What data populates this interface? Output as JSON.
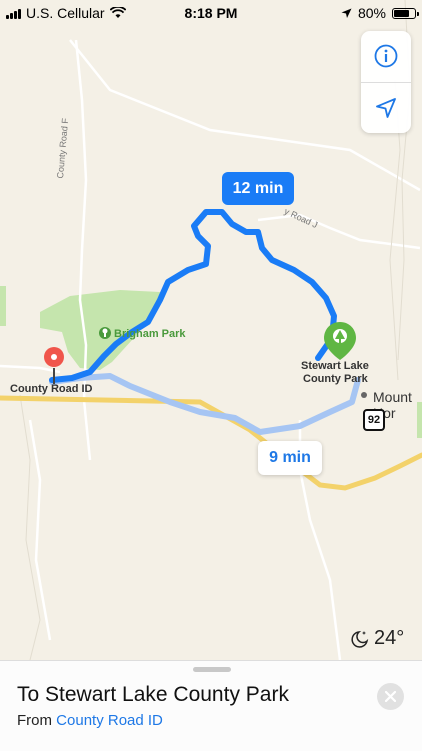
{
  "status_bar": {
    "carrier": "U.S. Cellular",
    "time": "8:18 PM",
    "battery_percent": "80%",
    "battery_level": 0.8
  },
  "map": {
    "routes": {
      "main_time": "12 min",
      "alt_time": "9 min"
    },
    "labels": {
      "origin": "County Road ID",
      "destination_line1": "Stewart Lake",
      "destination_line2": "County Park",
      "park": "Brigham Park",
      "town": "Mount Hor",
      "road_f": "County Road F",
      "road_j": "y Road J",
      "highway": "92"
    },
    "weather": {
      "temperature": "24°",
      "icon": "moon-stars-icon"
    },
    "colors": {
      "route_main": "#1a7cf6",
      "route_alt": "#a6c5f3",
      "park": "#c5e5ad",
      "destination_pin": "#5fb643",
      "origin_pin": "#f0554b"
    }
  },
  "controls": {
    "info_icon": "info-icon",
    "location_icon": "location-arrow-icon"
  },
  "sheet": {
    "title": "To Stewart Lake County Park",
    "from_prefix": "From",
    "from_place": "County Road ID"
  }
}
